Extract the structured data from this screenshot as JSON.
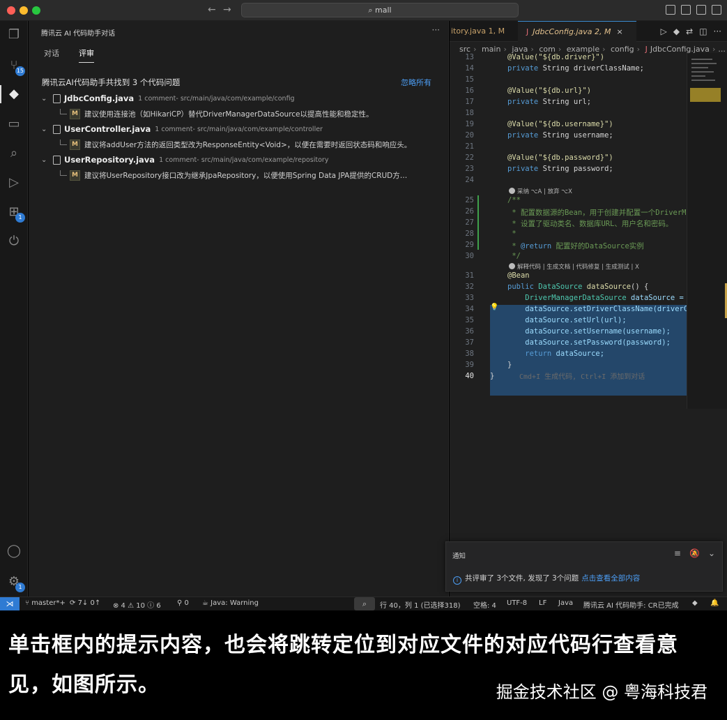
{
  "titlebar": {
    "search": "mall"
  },
  "activity": {
    "scm_badge": "15",
    "ext_badge": "1"
  },
  "panel": {
    "title": "腾讯云 AI 代码助手对话",
    "tabs": [
      "对话",
      "评审"
    ],
    "summary": "腾讯云AI代码助手共找到 3 个代码问题",
    "ignore_all": "忽略所有",
    "files": [
      {
        "name": "JdbcConfig.java",
        "meta": "1 comment- src/main/java/com/example/config",
        "comment": "建议使用连接池（如HikariCP）替代DriverManagerDataSource以提高性能和稳定性。"
      },
      {
        "name": "UserController.java",
        "meta": "1 comment- src/main/java/com/example/controller",
        "comment": "建议将addUser方法的返回类型改为ResponseEntity<Void>，以便在需要时返回状态码和响应头。"
      },
      {
        "name": "UserRepository.java",
        "meta": "1 comment- src/main/java/com/example/repository",
        "comment": "建议将UserRepository接口改为继承JpaRepository，以便使用Spring Data JPA提供的CRUD方…"
      }
    ],
    "m_label": "M"
  },
  "editor": {
    "tab_prev": "itory.java 1, M",
    "tab_active_icon": "J",
    "tab_active": "JdbcConfig.java 2, M",
    "tab_close": "×",
    "breadcrumb": [
      "src",
      "main",
      "java",
      "com",
      "example",
      "config"
    ],
    "breadcrumb_file": "JdbcConfig.java",
    "breadcrumb_tail": "...",
    "lines": {
      "n13": "13",
      "c13": "@Value(\"${db.driver}\")",
      "n14": "14",
      "c14a": "private",
      "c14b": " String driverClassName;",
      "n15": "15",
      "n16": "16",
      "c16": "@Value(\"${db.url}\")",
      "n17": "17",
      "c17a": "private",
      "c17b": " String url;",
      "n18": "18",
      "n19": "19",
      "c19": "@Value(\"${db.username}\")",
      "n20": "20",
      "c20a": "private",
      "c20b": " String username;",
      "n21": "21",
      "n22": "22",
      "c22": "@Value(\"${db.password}\")",
      "n23": "23",
      "c23a": "private",
      "c23b": " String password;",
      "n24": "24",
      "hint1": "采纳 ⌥A | 放弃 ⌥X",
      "n25": "25",
      "c25": "/**",
      "n26": "26",
      "c26": " * 配置数据源的Bean，用于创建并配置一个DriverMa",
      "n27": "27",
      "c27": " * 设置了驱动类名、数据库URL、用户名和密码。",
      "n28": "28",
      "c28": " *",
      "n29": "29",
      "c29a": " * ",
      "c29b": "@return",
      "c29c": " 配置好的DataSource实例",
      "n30": "30",
      "c30": " */",
      "hint2": "解释代码 | 生成文档 | 代码修复 | 生成测试 | X",
      "n31": "31",
      "c31": "@Bean",
      "n32": "32",
      "c32a": "public",
      "c32b": " DataSource ",
      "c32c": "dataSource",
      "c32d": "() {",
      "n33": "33",
      "c33a": "    DriverManagerDataSource ",
      "c33b": "dataSource =",
      "n34": "34",
      "c34": "    dataSource.setDriverClassName(driverC",
      "n35": "35",
      "c35": "    dataSource.setUrl(url);",
      "n36": "36",
      "c36": "    dataSource.setUsername(username);",
      "n37": "37",
      "c37": "    dataSource.setPassword(password);",
      "n38": "38",
      "c38a": "    return",
      "c38b": " dataSource;",
      "n39": "39",
      "c39": "}",
      "n40": "40",
      "c40": "}"
    },
    "ai_hint": "Cmd+I 生成代码, Ctrl+I 添加到对话"
  },
  "notification": {
    "title": "通知",
    "message": "共评审了 3个文件, 发现了 3个问题",
    "link": "点击查看全部内容"
  },
  "statusbar": {
    "branch": "master*+",
    "sync": "7↓ 0↑",
    "errors": "⊗ 4 ⚠ 10 ⓘ 6",
    "ports": "0",
    "java": "Java: Warning",
    "position": "行 40，列 1 (已选择318)",
    "spaces": "空格: 4",
    "encoding": "UTF-8",
    "eol": "LF",
    "language": "Java",
    "assistant": "腾讯云 AI 代码助手: CR已完成"
  },
  "caption": {
    "text": "单击框内的提示内容，也会将跳转定位到对应文件的对应代码行查看意见，如图所示。",
    "watermark": "掘金技术社区 @ 粤海科技君"
  },
  "colors": {
    "accent": "#2f7bd3",
    "link": "#4c9df3",
    "selection": "#264f78"
  }
}
